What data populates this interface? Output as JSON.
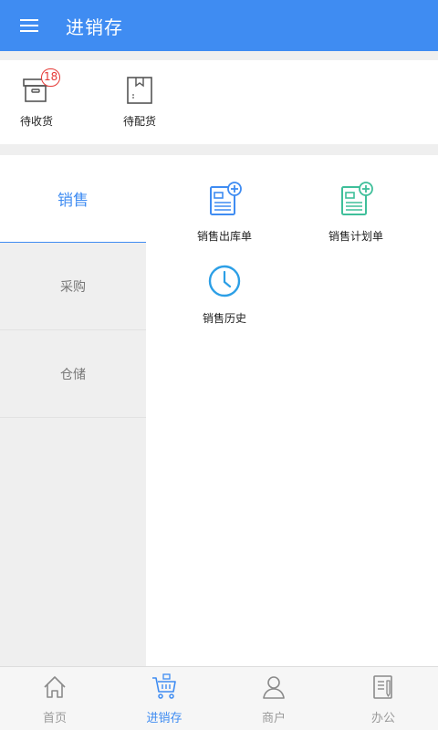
{
  "header": {
    "title": "进销存",
    "menu_icon": "hamburger-menu-icon",
    "background": "#3f8cf2"
  },
  "quick_actions": [
    {
      "label": "待收货",
      "icon": "box-icon",
      "badge": "18"
    },
    {
      "label": "待配货",
      "icon": "package-icon"
    }
  ],
  "sidebar": {
    "items": [
      {
        "label": "销售",
        "active": true
      },
      {
        "label": "采购",
        "active": false
      },
      {
        "label": "仓储",
        "active": false
      }
    ]
  },
  "grid": {
    "items": [
      {
        "label": "销售出库单",
        "icon": "document-add-icon",
        "color": "#3f8cf2"
      },
      {
        "label": "销售计划单",
        "icon": "document-add-icon",
        "color": "#3fbf9a"
      },
      {
        "label": "销售历史",
        "icon": "clock-icon",
        "color": "#2c9fe6"
      }
    ]
  },
  "bottom_nav": {
    "tabs": [
      {
        "label": "首页",
        "icon": "home-icon",
        "active": false
      },
      {
        "label": "进销存",
        "icon": "cart-icon",
        "active": true
      },
      {
        "label": "商户",
        "icon": "user-icon",
        "active": false
      },
      {
        "label": "办公",
        "icon": "notepad-icon",
        "active": false
      }
    ]
  },
  "colors": {
    "accent": "#3f8cf2",
    "badge": "#e53935",
    "inactive_text": "#9a9a9a"
  }
}
